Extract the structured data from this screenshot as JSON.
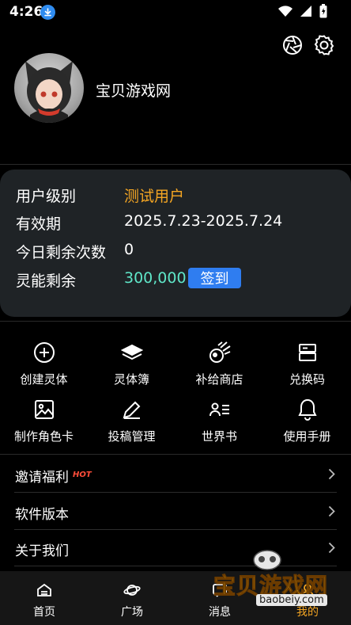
{
  "status_bar": {
    "time": "4:26"
  },
  "profile": {
    "username": "宝贝游戏网"
  },
  "info": {
    "rows": [
      {
        "label": "用户级别",
        "value": "测试用户"
      },
      {
        "label": "有效期",
        "value": "2025.7.23-2025.7.24"
      },
      {
        "label": "今日剩余次数",
        "value": "0"
      },
      {
        "label": "灵能剩余",
        "value": "300,000"
      }
    ],
    "signin_label": "签到"
  },
  "grid": [
    {
      "label": "创建灵体",
      "icon": "plus-circle-icon"
    },
    {
      "label": "灵体簿",
      "icon": "book-icon"
    },
    {
      "label": "补给商店",
      "icon": "comet-icon"
    },
    {
      "label": "兑换码",
      "icon": "redeem-ticket-icon"
    },
    {
      "label": "制作角色卡",
      "icon": "image-icon"
    },
    {
      "label": "投稿管理",
      "icon": "edit-icon"
    },
    {
      "label": "世界书",
      "icon": "user-list-icon"
    },
    {
      "label": "使用手册",
      "icon": "bell-icon"
    }
  ],
  "menu": [
    {
      "label": "邀请福利",
      "badge": "HOT"
    },
    {
      "label": "软件版本"
    },
    {
      "label": "关于我们"
    }
  ],
  "bottom_nav": [
    {
      "label": "首页",
      "icon": "home-icon"
    },
    {
      "label": "广场",
      "icon": "planet-icon"
    },
    {
      "label": "消息",
      "icon": "message-icon"
    },
    {
      "label": "我的",
      "icon": "profile-icon"
    }
  ],
  "watermark": {
    "text": "宝贝游戏网",
    "url": "baobeiy.com"
  },
  "colors": {
    "accent": "#2f7df0",
    "highlight": "#f5a623",
    "teal": "#5fe6c8",
    "card": "#1f2326"
  }
}
